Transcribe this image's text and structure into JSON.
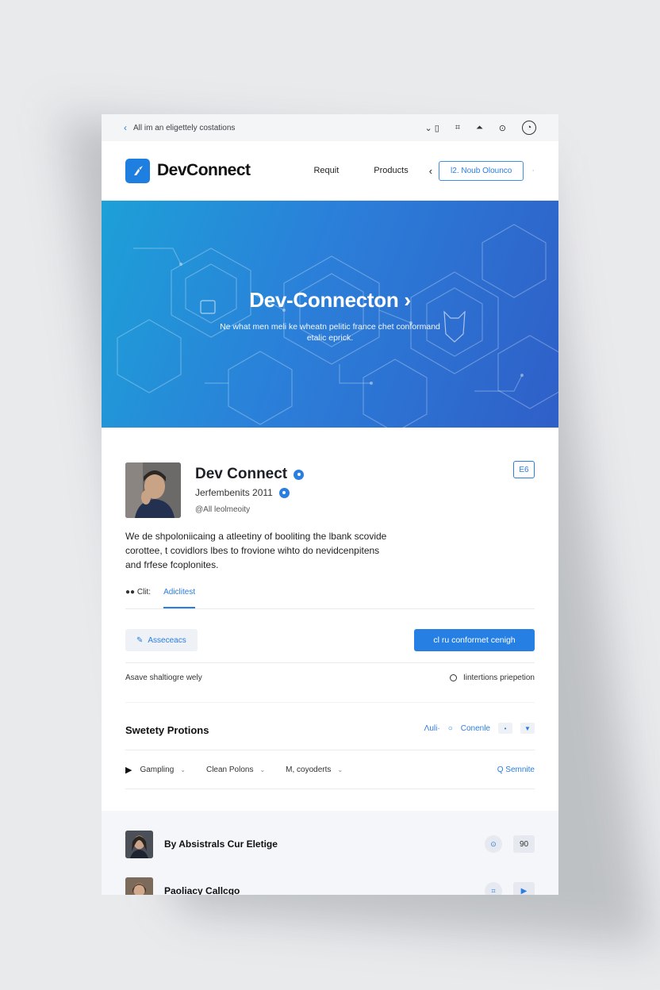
{
  "browser": {
    "url_text": "All im an eligettely costations",
    "tool_1": "⌄ ▯",
    "tool_2": "⌗",
    "tool_3": "⏶",
    "tool_4": "⊙"
  },
  "header": {
    "logo_text": "DevConnect",
    "nav": [
      "Requit",
      "Products"
    ],
    "nav_chevron": "‹",
    "cta_label": "l2.   Noub Olounco",
    "trailing": "·"
  },
  "hero": {
    "title": "Dev-Connecton ›",
    "subtitle_line1": "Ne what men meli ke wheatn pelitic france chet conformand",
    "subtitle_line2": "etalic eprick.",
    "gradient_start": "#1da0d8",
    "gradient_end": "#2f5fc8"
  },
  "profile": {
    "name": "Dev Connect",
    "joined": "Jerfembenits 2011",
    "handle": "@All leolmeoity",
    "edit_label": "E6",
    "bio_lines": [
      "We de shpoloniicaing a atleetiny of booliting the lbank scovide",
      "corottee, t covidlors lbes to frovione wihto do nevidcenpitens",
      "and frfese fcoplonites."
    ],
    "tabs": [
      "●● Clit:",
      "Adiclitest"
    ],
    "active_tab": 1
  },
  "actions": {
    "secondary_label": "Asseceacs",
    "primary_label": "cl ru conformet cenigh",
    "left_text": "Asave shaltiogre wely",
    "right_text": "Iintertions priepetion"
  },
  "section": {
    "title": "Swetety Protions",
    "ctrl_text": "Ʌuli·",
    "ctrl_link": "Conenle",
    "filters": [
      "Gampling",
      "Clean Polons",
      "M, coyoderts"
    ],
    "search_label": "Q  Semnite"
  },
  "list": {
    "items": [
      {
        "title": "By Absistrals Cur Eletige",
        "count": "90"
      },
      {
        "title": "Paoliacy Callcgo",
        "count": ""
      }
    ]
  },
  "colors": {
    "accent": "#2a7de1",
    "primary_button": "#2680e3"
  }
}
